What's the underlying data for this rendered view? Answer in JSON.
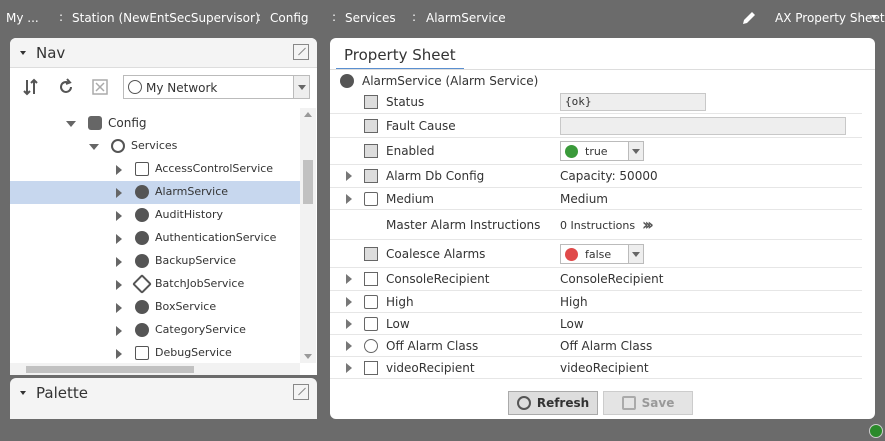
{
  "breadcrumb": {
    "items": [
      "My ...",
      "Station (NewEntSecSupervisor)",
      "Config",
      "Services",
      "AlarmService"
    ],
    "view_label": "AX Property Sheet"
  },
  "nav": {
    "title": "Nav",
    "network_select": "My Network",
    "tree": [
      {
        "label": "Config",
        "icon": "config-icon",
        "state": "expanded"
      },
      {
        "label": "Services",
        "icon": "services-icon",
        "state": "expanded"
      },
      {
        "label": "AccessControlService",
        "icon": "access-control-icon",
        "state": "collapsed"
      },
      {
        "label": "AlarmService",
        "icon": "alarm-icon",
        "state": "collapsed",
        "selected": true
      },
      {
        "label": "AuditHistory",
        "icon": "audit-icon",
        "state": "collapsed"
      },
      {
        "label": "AuthenticationService",
        "icon": "lock-icon",
        "state": "collapsed"
      },
      {
        "label": "BackupService",
        "icon": "backup-icon",
        "state": "collapsed"
      },
      {
        "label": "BatchJobService",
        "icon": "batch-job-icon",
        "state": "collapsed"
      },
      {
        "label": "BoxService",
        "icon": "box-icon",
        "state": "collapsed"
      },
      {
        "label": "CategoryService",
        "icon": "category-icon",
        "state": "collapsed"
      },
      {
        "label": "DebugService",
        "icon": "debug-icon",
        "state": "collapsed"
      }
    ]
  },
  "palette": {
    "title": "Palette"
  },
  "property_sheet": {
    "tab_label": "Property Sheet",
    "title": "AlarmService  (Alarm Service)",
    "rows": [
      {
        "name": "Status",
        "type": "field",
        "value": "{ok}"
      },
      {
        "name": "Fault Cause",
        "type": "field",
        "value": ""
      },
      {
        "name": "Enabled",
        "type": "combo",
        "value": "true",
        "dot_color": "#3a9a3a"
      },
      {
        "name": "Alarm Db Config",
        "type": "text",
        "value": "Capacity: 50000",
        "expandable": true
      },
      {
        "name": "Medium",
        "type": "text",
        "value": "Medium",
        "expandable": true
      },
      {
        "name": "Master Alarm Instructions",
        "type": "instructions",
        "value": "0 Instructions"
      },
      {
        "name": "Coalesce Alarms",
        "type": "combo",
        "value": "false",
        "dot_color": "#e04a4a"
      },
      {
        "name": "ConsoleRecipient",
        "type": "text",
        "value": "ConsoleRecipient",
        "expandable": true
      },
      {
        "name": "High",
        "type": "text",
        "value": "High",
        "expandable": true
      },
      {
        "name": "Low",
        "type": "text",
        "value": "Low",
        "expandable": true
      },
      {
        "name": "Off Alarm Class",
        "type": "text",
        "value": "Off Alarm Class",
        "expandable": true
      },
      {
        "name": "videoRecipient",
        "type": "text",
        "value": "videoRecipient",
        "expandable": true
      }
    ],
    "refresh_label": "Refresh",
    "save_label": "Save"
  },
  "colors": {
    "accent": "#5a8fd0",
    "selection": "#c7d7ee",
    "status_ok": "#2a8a2a"
  }
}
